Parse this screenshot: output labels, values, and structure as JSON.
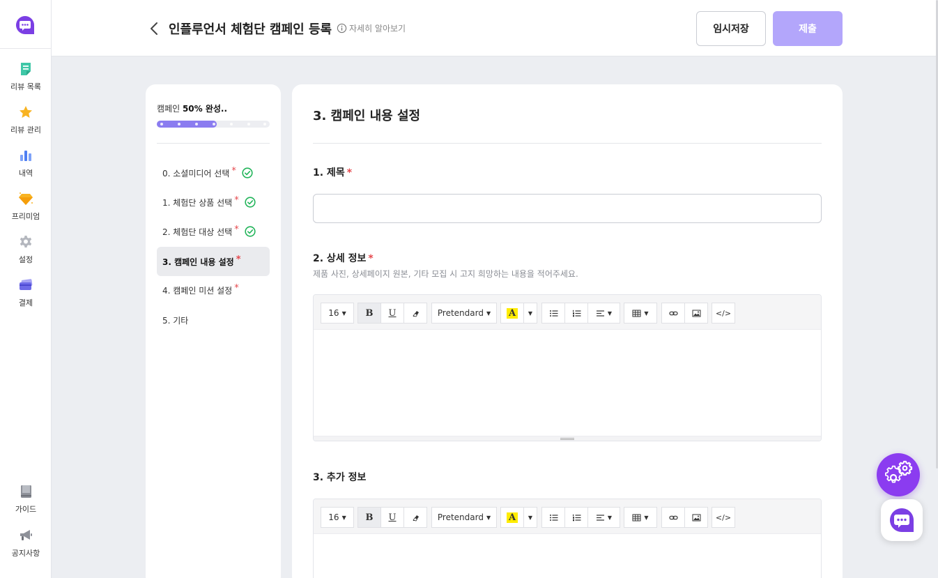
{
  "sidebar": {
    "items": [
      {
        "label": "리뷰 목록",
        "icon": "review-list-icon"
      },
      {
        "label": "리뷰 관리",
        "icon": "star-icon"
      },
      {
        "label": "내역",
        "icon": "bar-chart-icon"
      },
      {
        "label": "프리미엄",
        "icon": "diamond-icon"
      },
      {
        "label": "설정",
        "icon": "gear-icon"
      },
      {
        "label": "결제",
        "icon": "credit-card-icon"
      }
    ],
    "bottom_items": [
      {
        "label": "가이드",
        "icon": "book-icon"
      },
      {
        "label": "공지사항",
        "icon": "megaphone-icon"
      }
    ]
  },
  "header": {
    "title": "인플루언서 체험단 캠페인 등록",
    "more_link": "자세히 알아보기",
    "save_label": "임시저장",
    "submit_label": "제출"
  },
  "progress": {
    "prefix": "캠페인",
    "value_text": "50% 완성..",
    "percent": 0.53
  },
  "steps": [
    {
      "label": "0. 소셜미디어 선택",
      "required": "*",
      "completed": true
    },
    {
      "label": "1. 체험단 상품 선택",
      "required": "*",
      "completed": true
    },
    {
      "label": "2. 체험단 대상 선택",
      "required": "*",
      "completed": true
    },
    {
      "label": "3. 캠페인 내용 설정",
      "required": "*",
      "completed": false,
      "active": true
    },
    {
      "label": "4. 캠페인 미션 설정",
      "required": "*",
      "completed": false
    },
    {
      "label": "5. 기타",
      "required": "",
      "completed": false
    }
  ],
  "section": {
    "title": "3. 캠페인 내용 설정",
    "fields": {
      "title": {
        "label": "1. 제목",
        "required": "*",
        "value": "",
        "placeholder": ""
      },
      "detail": {
        "label": "2. 상세 정보",
        "required": "*",
        "helper": "제품 사진, 상세페이지 원본, 기타 모집 시 고지 희망하는 내용을 적어주세요."
      },
      "extra": {
        "label": "3. 추가 정보"
      }
    }
  },
  "editor_toolbar": {
    "font_size": "16",
    "bold": "B",
    "underline": "U",
    "font_family": "Pretendard",
    "highlight": "A",
    "code": "</>"
  },
  "colors": {
    "accent": "#8b7cf0",
    "submit_disabled": "#b3a6fb",
    "required": "#e5484d",
    "check": "#22b45a",
    "fab": "#8b3cf0"
  }
}
